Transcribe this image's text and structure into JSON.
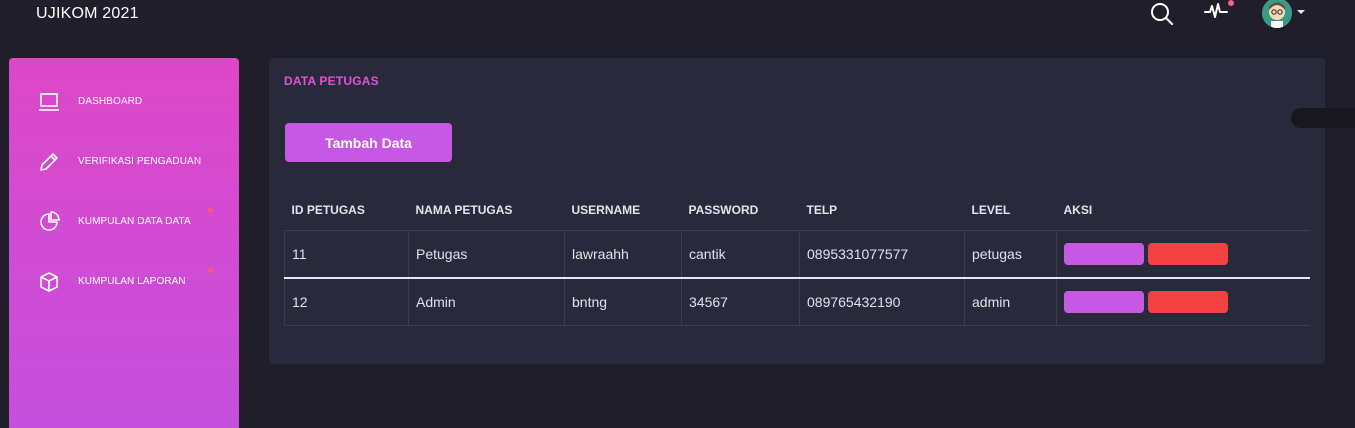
{
  "header": {
    "brand": "UJIKOM 2021",
    "icons": [
      "search-icon",
      "activity-icon",
      "avatar",
      "chevron-down-icon"
    ]
  },
  "sidebar": {
    "items": [
      {
        "label": "DASHBOARD",
        "icon": "laptop-icon",
        "dot": false
      },
      {
        "label": "VERIFIKASI PENGADUAN",
        "icon": "pencil-icon",
        "dot": false
      },
      {
        "label": "KUMPULAN DATA DATA",
        "icon": "pie-chart-icon",
        "dot": true
      },
      {
        "label": "KUMPULAN LAPORAN",
        "icon": "box-icon",
        "dot": true
      }
    ]
  },
  "main": {
    "title": "DATA PETUGAS",
    "add_button": "Tambah Data",
    "table": {
      "columns": [
        "ID PETUGAS",
        "NAMA PETUGAS",
        "USERNAME",
        "PASSWORD",
        "TELP",
        "LEVEL",
        "AKSI"
      ],
      "rows": [
        [
          "11",
          "Petugas",
          "lawraahh",
          "cantik",
          "0895331077577",
          "petugas"
        ],
        [
          "12",
          "Admin",
          "bntng",
          "34567",
          "089765432190",
          "admin"
        ]
      ]
    }
  },
  "colors": {
    "background": "#1f1e2a",
    "panel": "#282a3c",
    "accent": "#c659e3",
    "title": "#e353d4",
    "danger": "#f24142",
    "notification": "#ff5d8f"
  }
}
